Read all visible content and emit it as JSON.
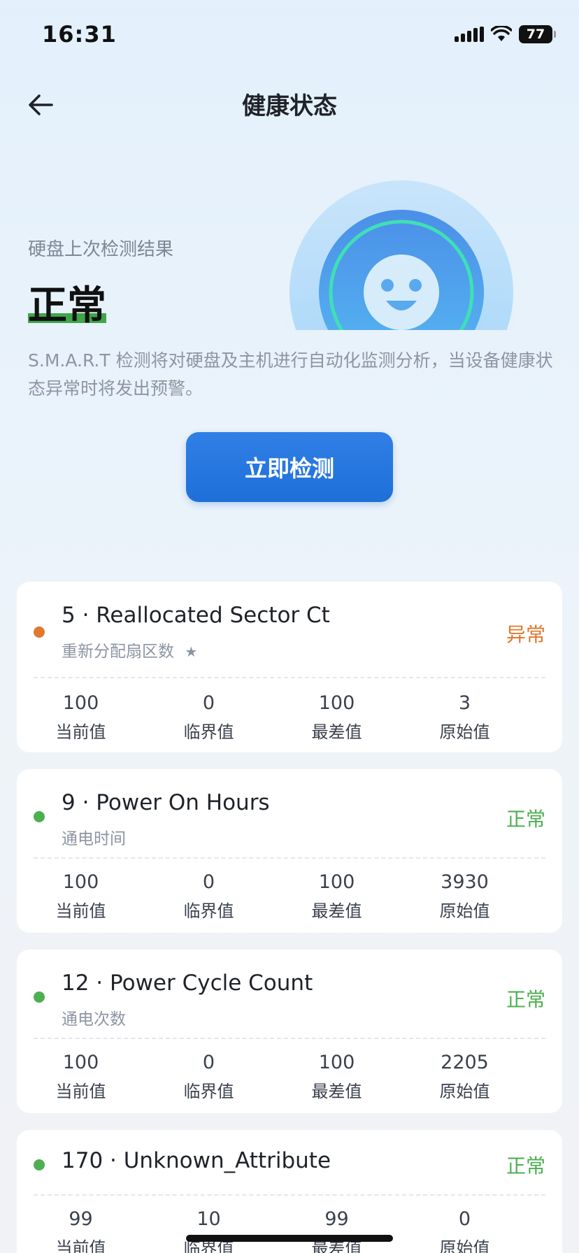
{
  "status_bar": {
    "time": "16:31",
    "battery": "77"
  },
  "nav": {
    "title": "健康状态"
  },
  "hero": {
    "subtitle": "硬盘上次检测结果",
    "status": "正常",
    "description": "S.M.A.R.T 检测将对硬盘及主机进行自动化监测分析，当设备健康状态异常时将发出预警。"
  },
  "action": {
    "check_label": "立即检测"
  },
  "stat_labels": {
    "current": "当前值",
    "threshold": "临界值",
    "worst": "最差值",
    "raw": "原始值"
  },
  "attributes": [
    {
      "title": "5 · Reallocated Sector Ct",
      "subtitle": "重新分配扇区数",
      "star": "★",
      "state": "异常",
      "state_color": "#e0782d",
      "current": "100",
      "threshold": "0",
      "worst": "100",
      "raw": "3"
    },
    {
      "title": "9 · Power On Hours",
      "subtitle": "通电时间",
      "state": "正常",
      "state_color": "#4caf50",
      "current": "100",
      "threshold": "0",
      "worst": "100",
      "raw": "3930"
    },
    {
      "title": "12 · Power Cycle Count",
      "subtitle": "通电次数",
      "state": "正常",
      "state_color": "#4caf50",
      "current": "100",
      "threshold": "0",
      "worst": "100",
      "raw": "2205"
    },
    {
      "title": "170 · Unknown_Attribute",
      "state": "正常",
      "state_color": "#4caf50",
      "current": "99",
      "threshold": "10",
      "worst": "99",
      "raw": "0"
    }
  ],
  "colors": {
    "accent": "#1f6fd9",
    "normal": "#4caf50",
    "warning": "#e0782d"
  }
}
